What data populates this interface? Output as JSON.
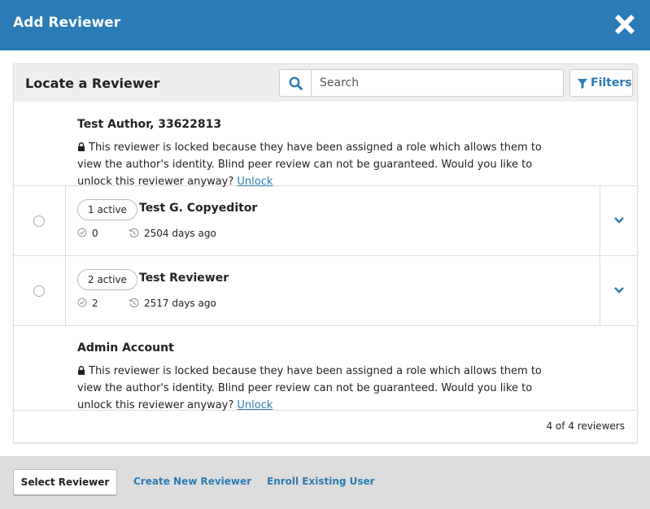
{
  "modal": {
    "title": "Add Reviewer",
    "close_icon": "close-icon"
  },
  "panel": {
    "title": "Locate a Reviewer",
    "search": {
      "placeholder": "Search",
      "value": ""
    },
    "filters_label": "Filters"
  },
  "reviewers": [
    {
      "name": "Test Author, 33622813",
      "locked": true,
      "lock_message": "This reviewer is locked because they have been assigned a role which allows them to view the author's identity. Blind peer review can not be guaranteed. Would you like to unlock this reviewer anyway?",
      "unlock_label": "Unlock"
    },
    {
      "name": "Test G. Copyeditor",
      "locked": false,
      "active_badge": "1 active",
      "completed": "0",
      "last_activity": "2504 days ago"
    },
    {
      "name": "Test Reviewer",
      "locked": false,
      "active_badge": "2 active",
      "completed": "2",
      "last_activity": "2517 days ago"
    },
    {
      "name": "Admin Account",
      "locked": true,
      "lock_message": "This reviewer is locked because they have been assigned a role which allows them to view the author's identity. Blind peer review can not be guaranteed. Would you like to unlock this reviewer anyway?",
      "unlock_label": "Unlock"
    }
  ],
  "count_text": "4 of 4 reviewers",
  "footer": {
    "select_label": "Select Reviewer",
    "create_label": "Create New Reviewer",
    "enroll_label": "Enroll Existing User"
  },
  "colors": {
    "brand": "#2a7bb6",
    "header_bg": "#2a7bb6",
    "footer_bg": "#dddddd"
  }
}
